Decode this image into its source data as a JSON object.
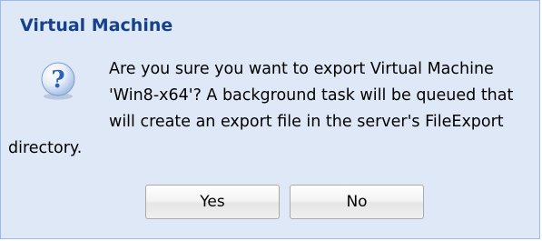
{
  "dialog": {
    "title": "Virtual Machine",
    "message": "Are you sure you want to export Virtual Machine 'Win8-x64'? A background task will be queued that will create an export file in the server's FileExport directory.",
    "icon": "question-icon",
    "buttons": {
      "yes_label": "Yes",
      "no_label": "No"
    }
  },
  "colors": {
    "title": "#15428b",
    "body_background": "#dfe8f6",
    "border": "#99bbe8",
    "icon_blue": "#2a63b8"
  }
}
